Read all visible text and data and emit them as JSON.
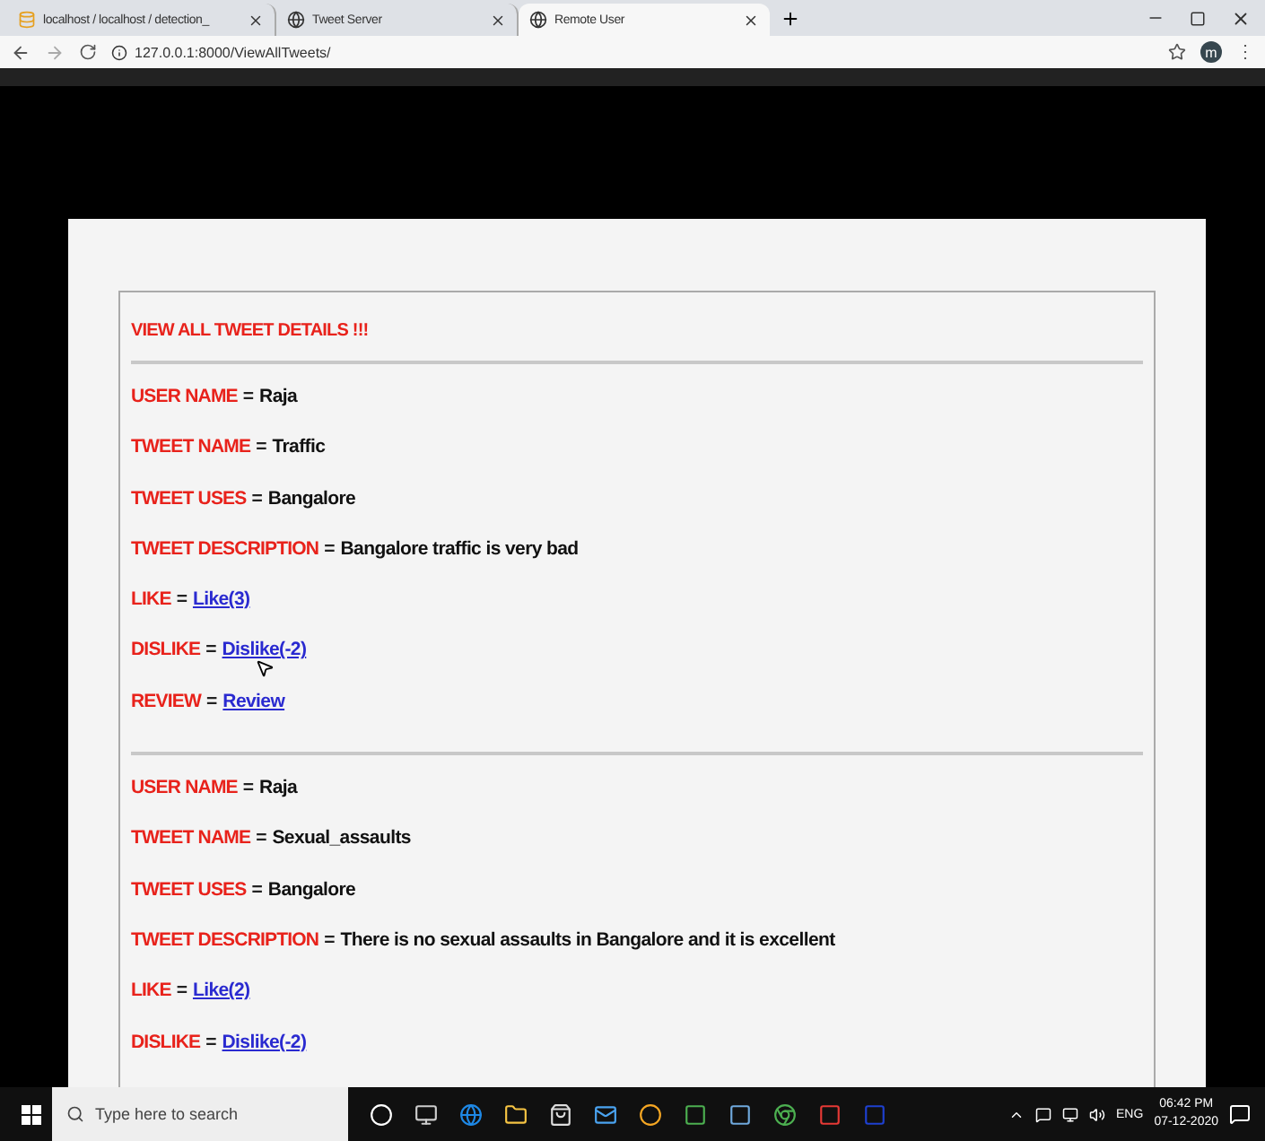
{
  "browser": {
    "tabs": [
      {
        "title": "localhost / localhost / detection_",
        "selected": false
      },
      {
        "title": "Tweet Server",
        "selected": false
      },
      {
        "title": "Remote User",
        "selected": true
      }
    ],
    "address": "127.0.0.1:8000/ViewAllTweets/",
    "avatar": "m",
    "menu": "⋮"
  },
  "page": {
    "heading": "VIEW ALL TWEET DETAILS !!!",
    "records": [
      [
        {
          "label": "USER NAME",
          "separator": "=",
          "value": "Raja",
          "kind": "text"
        },
        {
          "label": "TWEET NAME",
          "separator": "=",
          "value": "Traffic",
          "kind": "text"
        },
        {
          "label": "TWEET USES",
          "separator": "=",
          "value": "Bangalore",
          "kind": "text"
        },
        {
          "label": "TWEET DESCRIPTION",
          "separator": "=",
          "value": "Bangalore traffic is very bad",
          "kind": "text"
        },
        {
          "label": "LIKE",
          "separator": "=",
          "value": "Like(3)",
          "kind": "link"
        },
        {
          "label": "DISLIKE",
          "separator": "=",
          "value": "Dislike(-2)",
          "kind": "link"
        },
        {
          "label": "REVIEW",
          "separator": "=",
          "value": "Review",
          "kind": "link"
        }
      ],
      [
        {
          "label": "USER NAME",
          "separator": "=",
          "value": "Raja",
          "kind": "text"
        },
        {
          "label": "TWEET NAME",
          "separator": "=",
          "value": "Sexual_assaults",
          "kind": "text"
        },
        {
          "label": "TWEET USES",
          "separator": "=",
          "value": "Bangalore",
          "kind": "text"
        },
        {
          "label": "TWEET DESCRIPTION",
          "separator": "=",
          "value": "There is no sexual assaults in Bangalore and it is excellent",
          "kind": "text"
        },
        {
          "label": "LIKE",
          "separator": "=",
          "value": "Like(2)",
          "kind": "link"
        },
        {
          "label": "DISLIKE",
          "separator": "=",
          "value": "Dislike(-2)",
          "kind": "link"
        }
      ]
    ]
  },
  "taskbar": {
    "search": {
      "placeholder": "Type here to search"
    },
    "language": "ENG",
    "time": "06:42 PM",
    "date": "07-12-2020"
  }
}
